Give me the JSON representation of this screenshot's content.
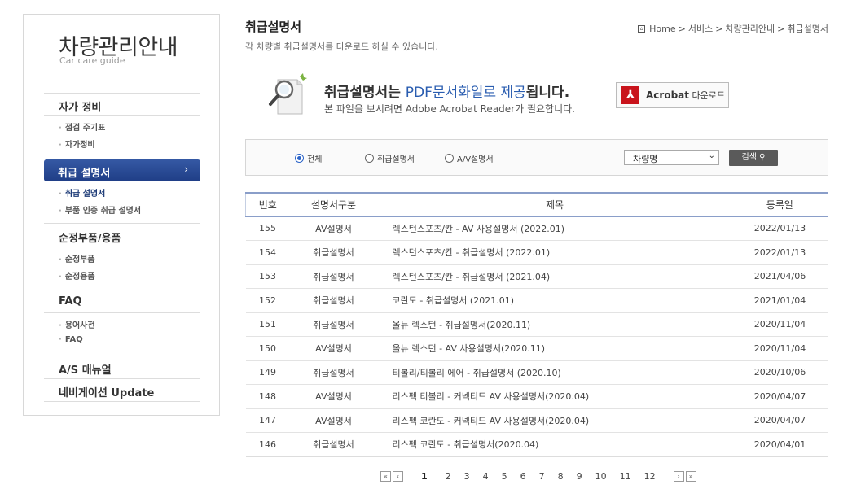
{
  "sidebar": {
    "title": "차량관리안내",
    "subtitle": "Car care guide",
    "groups": [
      {
        "label": "자가 정비",
        "items": [
          "점검 주기표",
          "자가정비"
        ]
      },
      {
        "label": "취급 설명서",
        "items": [
          "취급 설명서",
          "부품 인증 취급 설명서"
        ]
      },
      {
        "label": "순정부품/용품",
        "items": [
          "순정부품",
          "순정용품"
        ]
      },
      {
        "label": "FAQ",
        "items": [
          "용어사전",
          "FAQ"
        ]
      },
      {
        "label": "A/S 매뉴얼",
        "items": []
      },
      {
        "label": "네비게이션 Update",
        "items": []
      }
    ],
    "active_chevron": "›"
  },
  "header": {
    "title": "취급설명서",
    "description": "각 차량별 취급설명서를 다운로드 하실 수 있습니다.",
    "breadcrumb": [
      "Home",
      "서비스",
      "차량관리안내",
      "취급설명서"
    ],
    "breadcrumb_sep": ">"
  },
  "banner": {
    "headline_a": "취급설명서는 ",
    "headline_b": "PDF문서화일로 제공",
    "headline_c": "됩니다.",
    "sub": "본 파일을 보시려면 Adobe Acrobat Reader가 필요합니다.",
    "acrobat_bold": "Acrobat",
    "acrobat_rest": " 다운로드"
  },
  "filter": {
    "radios": [
      "전체",
      "취급설명서",
      "A/V설명서"
    ],
    "selected_radio": 0,
    "select_value": "차량명",
    "search_label": "검색"
  },
  "table": {
    "headers": [
      "번호",
      "설명서구분",
      "제목",
      "등록일"
    ],
    "rows": [
      [
        "155",
        "AV설명서",
        "렉스턴스포츠/칸 - AV 사용설명서 (2022.01)",
        "2022/01/13"
      ],
      [
        "154",
        "취급설명서",
        "렉스턴스포츠/칸 - 취급설명서 (2022.01)",
        "2022/01/13"
      ],
      [
        "153",
        "취급설명서",
        "렉스턴스포츠/칸 - 취급설명서 (2021.04)",
        "2021/04/06"
      ],
      [
        "152",
        "취급설명서",
        "코란도 - 취급설명서 (2021.01)",
        "2021/01/04"
      ],
      [
        "151",
        "취급설명서",
        "올뉴 렉스턴 - 취급설명서(2020.11)",
        "2020/11/04"
      ],
      [
        "150",
        "AV설명서",
        "올뉴 렉스턴 - AV 사용설명서(2020.11)",
        "2020/11/04"
      ],
      [
        "149",
        "취급설명서",
        "티볼리/티볼리 에어 - 취급설명서 (2020.10)",
        "2020/10/06"
      ],
      [
        "148",
        "AV설명서",
        "리스펙 티볼리 - 커넥티드 AV 사용설명서(2020.04)",
        "2020/04/07"
      ],
      [
        "147",
        "AV설명서",
        "리스펙 코란도 - 커넥티드 AV 사용설명서(2020.04)",
        "2020/04/07"
      ],
      [
        "146",
        "취급설명서",
        "리스펙 코란도 - 취급설명서(2020.04)",
        "2020/04/01"
      ]
    ]
  },
  "pagination": {
    "pages": [
      "1",
      "2",
      "3",
      "4",
      "5",
      "6",
      "7",
      "8",
      "9",
      "10",
      "11",
      "12"
    ],
    "current": "1"
  },
  "colors": {
    "accent": "#1f3e86",
    "link_blue": "#2a5db0",
    "acrobat_red": "#c9141c"
  }
}
